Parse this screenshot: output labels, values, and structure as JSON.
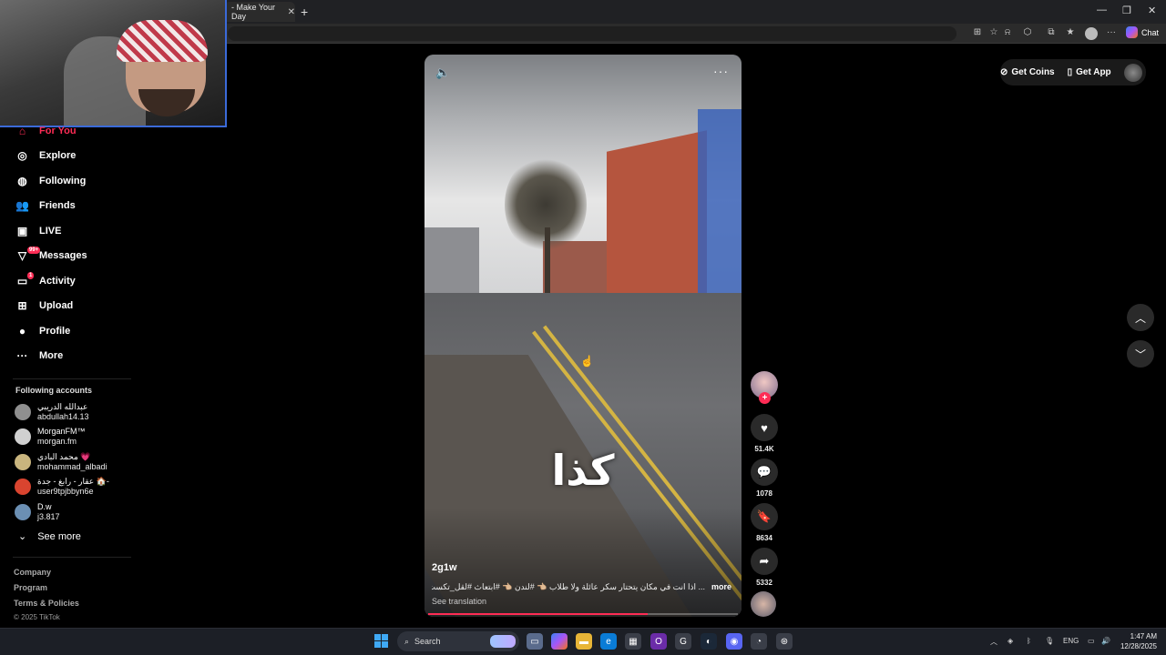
{
  "browser": {
    "tab_title": "- Make Your Day",
    "tab_close": "✕",
    "new_tab": "+",
    "chat_label": "Chat",
    "window_controls": [
      "—",
      "❐",
      "✕"
    ]
  },
  "sidebar": {
    "nav": [
      {
        "label": "For You",
        "icon": "home-icon",
        "glyph": "⌂",
        "active": true
      },
      {
        "label": "Explore",
        "icon": "compass-icon",
        "glyph": "◎"
      },
      {
        "label": "Following",
        "icon": "following-icon",
        "glyph": "◍"
      },
      {
        "label": "Friends",
        "icon": "friends-icon",
        "glyph": "👥"
      },
      {
        "label": "LIVE",
        "icon": "live-icon",
        "glyph": "▣"
      },
      {
        "label": "Messages",
        "icon": "messages-icon",
        "glyph": "▽",
        "badge": "99+"
      },
      {
        "label": "Activity",
        "icon": "activity-icon",
        "glyph": "▭",
        "badge": "1"
      },
      {
        "label": "Upload",
        "icon": "upload-icon",
        "glyph": "⊞"
      },
      {
        "label": "Profile",
        "icon": "profile-icon",
        "glyph": "●"
      },
      {
        "label": "More",
        "icon": "more-icon",
        "glyph": "···",
        "dot": true
      }
    ],
    "following_title": "Following accounts",
    "accounts": [
      {
        "name": "عبدالله الدريبي",
        "handle": "abdullah14.13",
        "color": "#8f8f8f"
      },
      {
        "name": "MorganFM™",
        "handle": "morgan.fm",
        "color": "#d0d0d0"
      },
      {
        "name": "محمد البادي 💗",
        "handle": "mohammad_albadi",
        "color": "#c9b57e"
      },
      {
        "name": "عقار - رابغ - جدة 🏠-",
        "handle": "user9tpjbbyn6e",
        "color": "#d9442f"
      },
      {
        "name": "D.w",
        "handle": "j3.817",
        "color": "#6b8fb3"
      }
    ],
    "see_more": "See more",
    "footer": [
      "Company",
      "Program",
      "Terms & Policies"
    ],
    "copyright": "© 2025 TikTok"
  },
  "video": {
    "caption": "كذا",
    "author": "2g1w",
    "description": "... اذا انت في مكان يتحتار سكر عائلة ولا طلاب 👈🏼 #لندن 👈🏼 #ابتعاث #لقل_تكست",
    "more": "more",
    "see_translation": "See translation",
    "progress": 0.71
  },
  "actions": {
    "follow": "+",
    "likes": "51.4K",
    "comments": "1078",
    "saves": "8634",
    "shares": "5332"
  },
  "top_right": {
    "get_coins": "Get Coins",
    "get_app": "Get App"
  },
  "taskbar": {
    "search": "Search",
    "language": "ENG",
    "time": "1:47 AM",
    "date": "12/28/2025"
  }
}
